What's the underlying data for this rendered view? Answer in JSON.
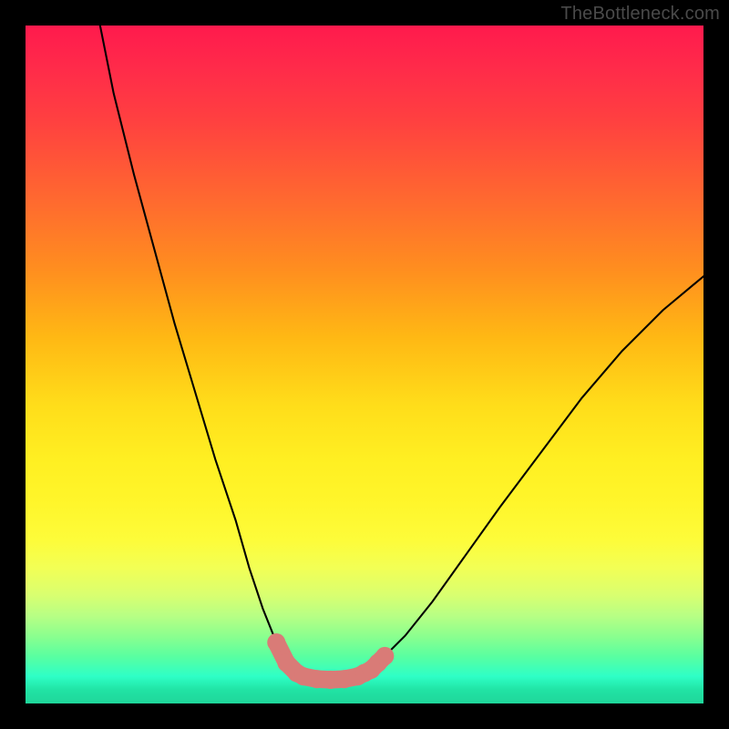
{
  "watermark": {
    "text": "TheBottleneck.com"
  },
  "chart_data": {
    "type": "line",
    "title": "",
    "xlabel": "",
    "ylabel": "",
    "xlim": [
      0,
      100
    ],
    "ylim": [
      0,
      100
    ],
    "grid": false,
    "legend": false,
    "series": [
      {
        "name": "left-branch",
        "x": [
          11,
          13,
          16,
          19,
          22,
          25,
          28,
          31,
          33,
          35,
          37,
          38.5,
          40,
          41
        ],
        "y": [
          100,
          90,
          78,
          67,
          56,
          46,
          36,
          27,
          20,
          14,
          9,
          6,
          4.5,
          4
        ]
      },
      {
        "name": "right-branch",
        "x": [
          49,
          51,
          53,
          56,
          60,
          65,
          70,
          76,
          82,
          88,
          94,
          100
        ],
        "y": [
          4,
          5,
          7,
          10,
          15,
          22,
          29,
          37,
          45,
          52,
          58,
          63
        ]
      },
      {
        "name": "floor",
        "x": [
          41,
          43,
          45,
          47,
          49
        ],
        "y": [
          4,
          3.6,
          3.5,
          3.6,
          4
        ]
      }
    ],
    "markers": {
      "name": "highlight-markers",
      "color": "#d97b77",
      "points": [
        {
          "x": 37.0,
          "y": 9.0
        },
        {
          "x": 38.5,
          "y": 6.0
        },
        {
          "x": 40.0,
          "y": 4.5
        },
        {
          "x": 41.0,
          "y": 4.0
        },
        {
          "x": 43.0,
          "y": 3.6
        },
        {
          "x": 45.0,
          "y": 3.5
        },
        {
          "x": 47.0,
          "y": 3.6
        },
        {
          "x": 49.0,
          "y": 4.0
        },
        {
          "x": 50.0,
          "y": 4.5
        },
        {
          "x": 51.0,
          "y": 5.0
        },
        {
          "x": 52.0,
          "y": 6.0
        },
        {
          "x": 53.0,
          "y": 7.0
        }
      ]
    },
    "background_gradient": {
      "top": "#ff1a4d",
      "mid": "#ffef22",
      "bottom": "#1fd69a"
    }
  }
}
